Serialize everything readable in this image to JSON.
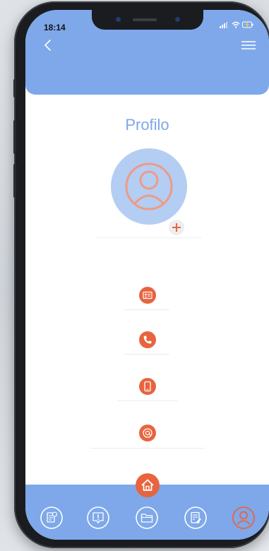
{
  "status_bar": {
    "time": "18:14"
  },
  "profile": {
    "title": "Profilo"
  },
  "colors": {
    "primary": "#7ea8ea",
    "accent": "#e8643f",
    "avatar_bg": "#b4cdf3"
  },
  "icons": {
    "fields": [
      "id-card-icon",
      "phone-icon",
      "mobile-phone-icon",
      "at-sign-icon"
    ],
    "nav": [
      "invoice-icon",
      "alert-icon",
      "folder-icon",
      "document-edit-icon",
      "profile-icon"
    ],
    "home": "home-icon"
  }
}
